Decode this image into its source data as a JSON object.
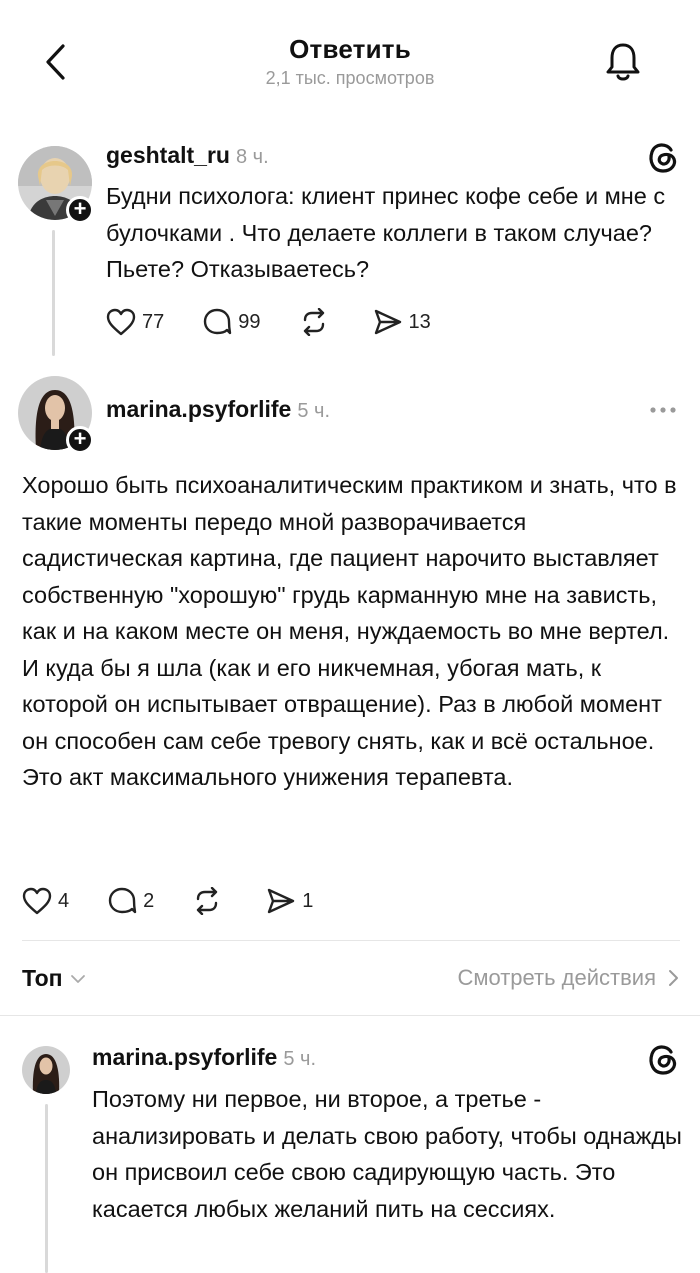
{
  "header": {
    "title": "Ответить",
    "subtitle": "2,1 тыс. просмотров"
  },
  "original_post": {
    "username": "geshtalt_ru",
    "time": "8 ч.",
    "text": "Будни психолога: клиент принес кофе себе и мне с булочками . Что делаете коллеги в таком случае? Пьете? Отказываетесь?",
    "likes": "77",
    "comments": "99",
    "shares": "13"
  },
  "reply_post": {
    "username": "marina.psyforlife",
    "time": "5 ч.",
    "text": "Хорошо быть психоаналитическим практиком и знать, что в такие моменты передо мной разворачивается садистическая картина, где пациент нарочито выставляет собственную \"хорошую\" грудь карманную мне на зависть, как и на каком месте он меня, нуждаемость во мне вертел. И куда бы я шла (как и его никчемная, убогая мать, к которой он испытывает отвращение). Раз в любой момент он способен сам себе тревогу снять, как и всё остальное. Это акт максимального унижения терапевта.",
    "likes": "4",
    "comments": "2",
    "shares": "1"
  },
  "filter": {
    "label": "Топ",
    "view_activity": "Смотреть действия"
  },
  "comment": {
    "username": "marina.psyforlife",
    "time": "5 ч.",
    "text": "Поэтому ни первое, ни второе, а третье - анализировать и делать свою работу, чтобы однажды он присвоил себе свою садирующую часть. Это касается любых желаний пить на сессиях."
  },
  "icons": {
    "back": "chevron-left-icon",
    "bell": "bell-icon",
    "threads": "threads-logo-icon",
    "more": "more-dots-icon",
    "like": "heart-icon",
    "comment": "comment-icon",
    "repost": "repost-icon",
    "share": "send-icon"
  }
}
